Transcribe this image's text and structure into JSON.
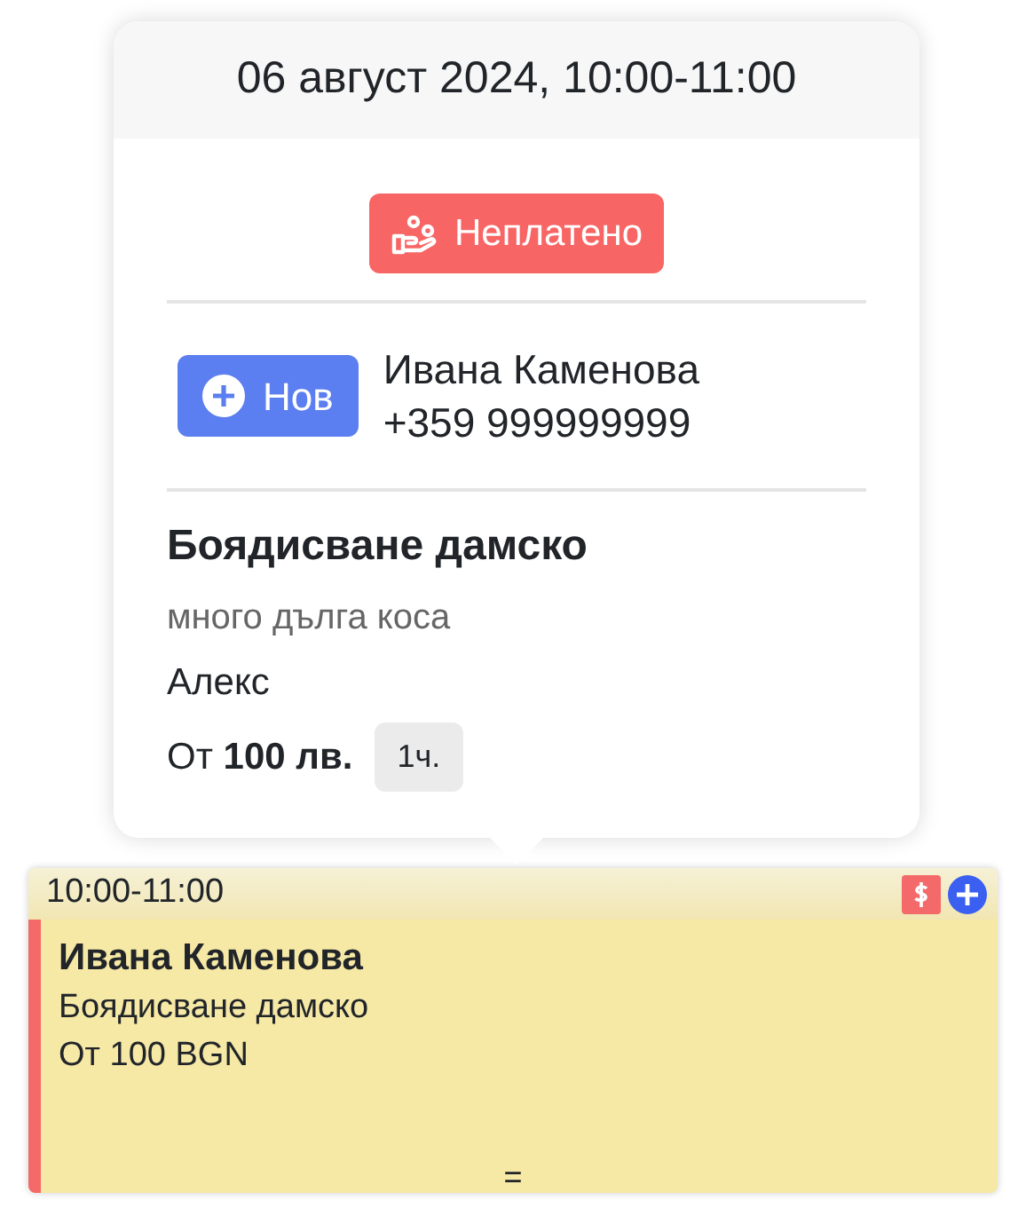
{
  "popover": {
    "title": "06 август 2024, 10:00-11:00",
    "payment_badge": "Неплатено",
    "client_tag": "Нов",
    "client_name": "Ивана Каменова",
    "client_phone": "+359 999999999",
    "service": "Боядисване дамско",
    "note": "много дълга коса",
    "staff": "Алекс",
    "price": "От **100 лв.**",
    "duration": "1ч."
  },
  "event": {
    "time": "10:00-11:00",
    "paid": false,
    "client_name": "Ивана Каменова",
    "service": "Боядисване дамско",
    "price": "От 100 BGN",
    "resize_handle": "="
  }
}
